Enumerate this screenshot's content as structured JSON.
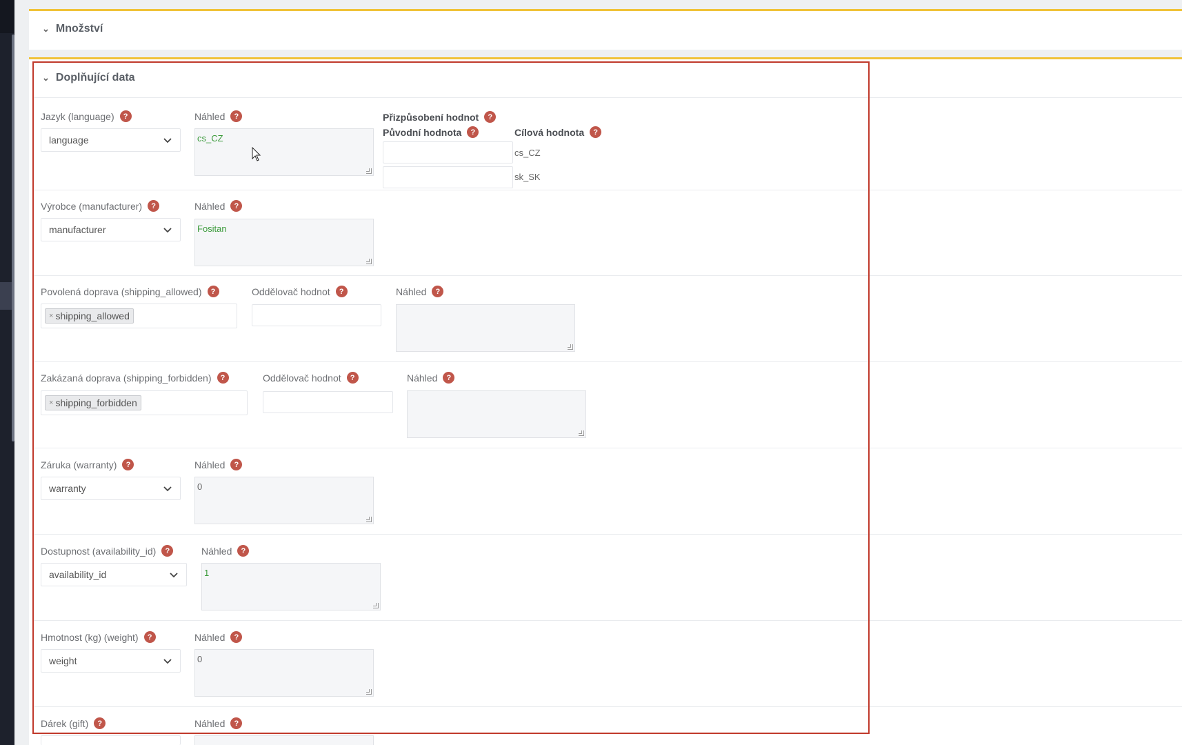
{
  "sections": {
    "mnozstvi": "Množství",
    "doplnujici": "Doplňující data"
  },
  "help_glyph": "?",
  "fields": {
    "language": {
      "label": "Jazyk (language)",
      "select": "language",
      "preview_label": "Náhled",
      "preview": "cs_CZ"
    },
    "mapping": {
      "title": "Přizpůsobení hodnot",
      "orig_header": "Původní hodnota",
      "target_header": "Cílová hodnota",
      "rows": [
        {
          "orig": "",
          "target": "cs_CZ"
        },
        {
          "orig": "",
          "target": "sk_SK"
        }
      ]
    },
    "manufacturer": {
      "label": "Výrobce (manufacturer)",
      "select": "manufacturer",
      "preview_label": "Náhled",
      "preview": "Fositan"
    },
    "shipping_allowed": {
      "label": "Povolená doprava (shipping_allowed)",
      "tag": "shipping_allowed",
      "separator_label": "Oddělovač hodnot",
      "preview_label": "Náhled",
      "preview": ""
    },
    "shipping_forbidden": {
      "label": "Zakázaná doprava (shipping_forbidden)",
      "tag": "shipping_forbidden",
      "separator_label": "Oddělovač hodnot",
      "preview_label": "Náhled",
      "preview": ""
    },
    "warranty": {
      "label": "Záruka (warranty)",
      "select": "warranty",
      "preview_label": "Náhled",
      "preview": "0"
    },
    "availability": {
      "label": "Dostupnost (availability_id)",
      "select": "availability_id",
      "preview_label": "Náhled",
      "preview": "1"
    },
    "weight": {
      "label": "Hmotnost (kg) (weight)",
      "select": "weight",
      "preview_label": "Náhled",
      "preview": "0"
    },
    "gift": {
      "label": "Dárek (gift)",
      "preview_label": "Náhled"
    }
  },
  "tag_remove": "×",
  "colors": {
    "accent": "#f0c238",
    "highlight_box": "#c0392b",
    "help_icon": "#c0564a",
    "preview_text": "#3a9a3a"
  }
}
